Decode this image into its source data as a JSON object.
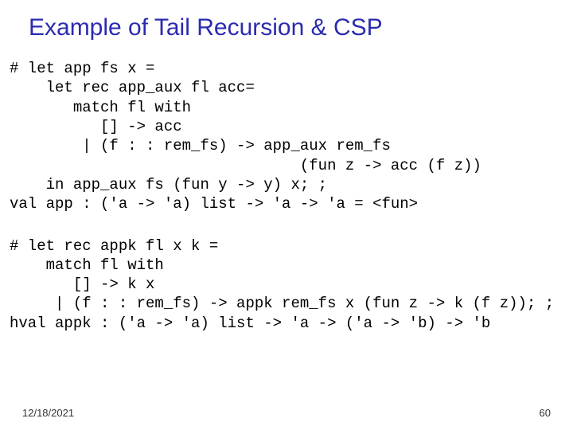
{
  "title": "Example of Tail Recursion & CSP",
  "code1": "# let app fs x =\n    let rec app_aux fl acc=\n       match fl with\n          [] -> acc\n        | (f : : rem_fs) -> app_aux rem_fs\n                                (fun z -> acc (f z))\n    in app_aux fs (fun y -> y) x; ;\nval app : ('a -> 'a) list -> 'a -> 'a = <fun>",
  "code2": "# let rec appk fl x k =\n    match fl with\n       [] -> k x\n     | (f : : rem_fs) -> appk rem_fs x (fun z -> k (f z)); ;\nhval appk : ('a -> 'a) list -> 'a -> ('a -> 'b) -> 'b",
  "footer": {
    "date": "12/18/2021",
    "page": "60"
  }
}
